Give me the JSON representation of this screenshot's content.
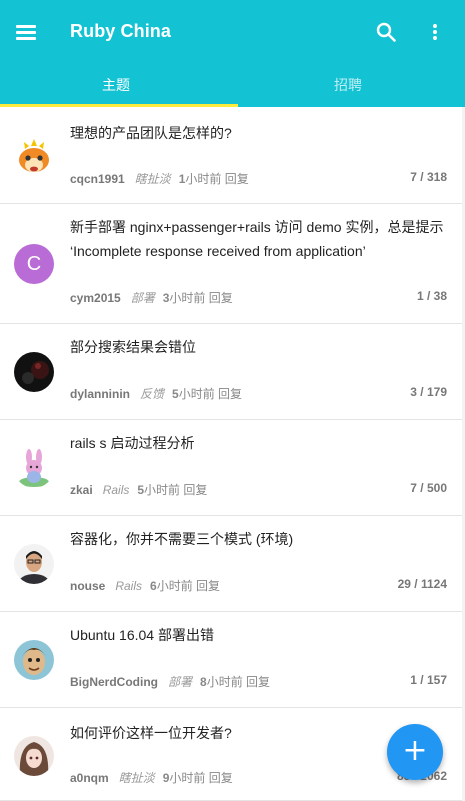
{
  "app": {
    "title": "Ruby China"
  },
  "tabs": [
    {
      "label": "主题",
      "active": true
    },
    {
      "label": "招聘",
      "active": false
    }
  ],
  "colors": {
    "appbar": "#14c3d3",
    "indicator": "#ffeb3b",
    "fab": "#2196f3"
  },
  "fab": {
    "icon": "plus-icon",
    "label": "+"
  },
  "topics": [
    {
      "title": "理想的产品团队是怎样的?",
      "user": "cqcn1991",
      "node": "瞎扯淡",
      "time_num": "1",
      "time_text": "小时前 回复",
      "counts": "7 / 318",
      "avatar": "fox-avatar"
    },
    {
      "title": "新手部署 nginx+passenger+rails 访问 demo 实例，总是提示 ‘Incomplete response received from application’",
      "user": "cym2015",
      "node": "部署",
      "time_num": "3",
      "time_text": "小时前 回复",
      "counts": "1 / 38",
      "avatar": "letter-avatar",
      "avatar_letter": "C"
    },
    {
      "title": "部分搜索结果会错位",
      "user": "dylanninin",
      "node": "反馈",
      "time_num": "5",
      "time_text": "小时前 回复",
      "counts": "3 / 179",
      "avatar": "dark-avatar"
    },
    {
      "title": "rails s 启动过程分析",
      "user": "zkai",
      "node": "Rails",
      "time_num": "5",
      "time_text": "小时前 回复",
      "counts": "7 / 500",
      "avatar": "bunny-avatar"
    },
    {
      "title": "容器化，你并不需要三个模式 (环境)",
      "user": "nouse",
      "node": "Rails",
      "time_num": "6",
      "time_text": "小时前 回复",
      "counts": "29 / 1124",
      "avatar": "person-avatar"
    },
    {
      "title": "Ubuntu 16.04 部署出错",
      "user": "BigNerdCoding",
      "node": "部署",
      "time_num": "8",
      "time_text": "小时前 回复",
      "counts": "1 / 157",
      "avatar": "cartoon-avatar"
    },
    {
      "title": "如何评价这样一位开发者?",
      "user": "a0nqm",
      "node": "瞎扯淡",
      "time_num": "9",
      "time_text": "小时前 回复",
      "counts": "88 / 2062",
      "avatar": "anime-avatar"
    }
  ]
}
